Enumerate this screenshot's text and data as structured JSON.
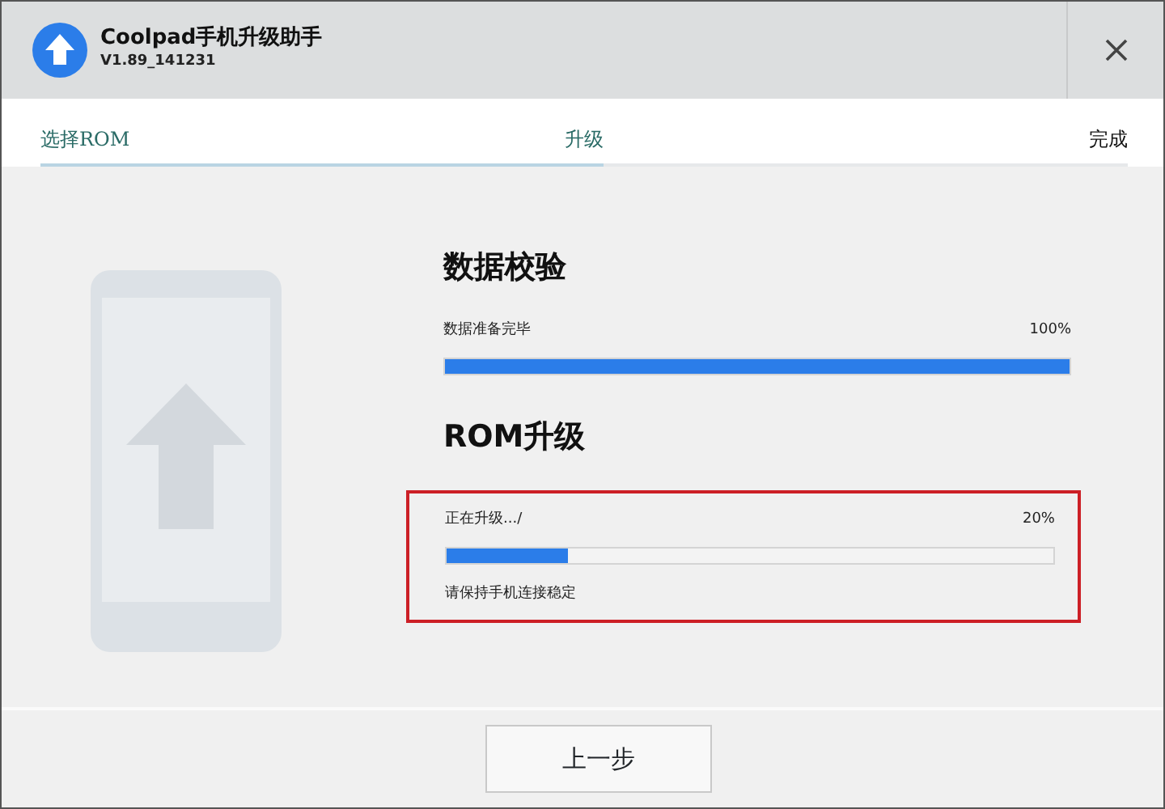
{
  "window": {
    "title": "Coolpad手机升级助手",
    "version": "V1.89_141231"
  },
  "steps": [
    {
      "label": "选择ROM",
      "reached": true
    },
    {
      "label": "升级",
      "reached": true
    },
    {
      "label": "完成",
      "reached": false
    }
  ],
  "sections": [
    {
      "heading": "数据校验",
      "status": "数据准备完毕",
      "percent": "100%",
      "level": 1.0,
      "highlighted": false
    },
    {
      "heading": "ROM升级",
      "status": "正在升级.../",
      "percent": "20%",
      "level": 0.2,
      "highlighted": true,
      "note": "请保持手机连接稳定"
    }
  ],
  "buttons": [
    "上一步"
  ]
}
